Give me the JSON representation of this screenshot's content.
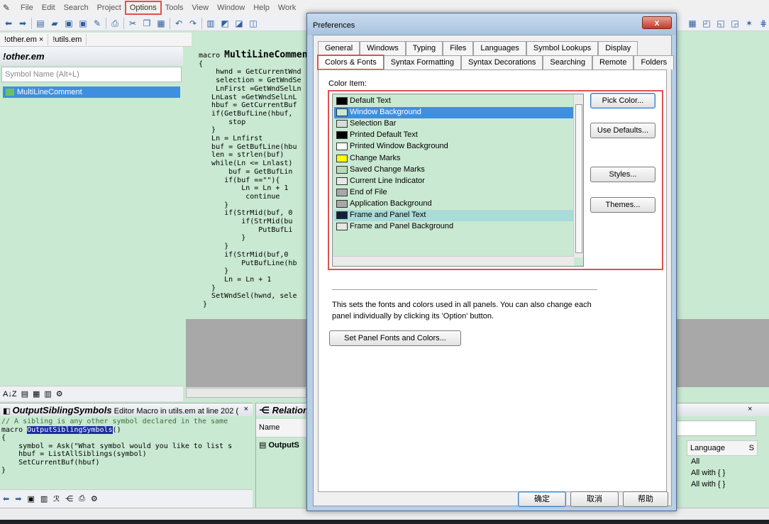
{
  "menubar": {
    "items": [
      "File",
      "Edit",
      "Search",
      "Project",
      "Options",
      "Tools",
      "View",
      "Window",
      "Help",
      "Work"
    ]
  },
  "file_tabs": [
    "!other.em",
    "!utils.em"
  ],
  "symbol_panel": {
    "title": "!other.em",
    "search_placeholder": "Symbol Name (Alt+L)",
    "item": "MultiLineComment"
  },
  "editor": {
    "lines": [
      [
        "macro ",
        "MultiLineCommen"
      ],
      [
        "{",
        ""
      ],
      [
        "    hwnd = GetCurrentWnd",
        ""
      ],
      [
        "    selection = GetWndSe",
        ""
      ],
      [
        "    LnFirst =GetWndSelLn",
        ""
      ],
      [
        "   LnLast =GetWndSelLnL",
        ""
      ],
      [
        "   hbuf = GetCurrentBuf",
        ""
      ],
      [
        "   if(GetBufLine(hbuf,",
        ""
      ],
      [
        "       stop",
        ""
      ],
      [
        "   }",
        ""
      ],
      [
        "   Ln = Lnfirst",
        ""
      ],
      [
        "   buf = GetBufLine(hbu",
        ""
      ],
      [
        "   len = strlen(buf)",
        ""
      ],
      [
        "   while(Ln <= Lnlast)",
        ""
      ],
      [
        "       buf = GetBufLin",
        ""
      ],
      [
        "      if(buf ==\"\"){",
        ""
      ],
      [
        "          Ln = Ln + 1",
        ""
      ],
      [
        "           continue",
        ""
      ],
      [
        "      }",
        ""
      ],
      [
        "      if(StrMid(buf, 0",
        ""
      ],
      [
        "          if(StrMid(bu",
        ""
      ],
      [
        "              PutBufLi",
        ""
      ],
      [
        "          }",
        ""
      ],
      [
        "      }",
        ""
      ],
      [
        "      if(StrMid(buf,0",
        ""
      ],
      [
        "          PutBufLine(hb",
        ""
      ],
      [
        "      }",
        ""
      ],
      [
        "      Ln = Ln + 1",
        ""
      ],
      [
        "   }",
        ""
      ],
      [
        "   SetWndSel(hwnd, sele",
        ""
      ],
      [
        " }",
        ""
      ]
    ]
  },
  "context_panel": {
    "symbol": "OutputSiblingSymbols",
    "info": "Editor Macro in utils.em at line 202 (",
    "code": [
      "// A sibling is any other symbol declared in the same ",
      "macro ",
      "{",
      "    symbol = Ask(\"What symbol would you like to list s",
      "    hbuf = ListAllSiblings(symbol)",
      "    SetCurrentBuf(hbuf)",
      "}"
    ],
    "macro_name": "OutputSiblingSymbols",
    "macro_paren": "()"
  },
  "relation_panel": {
    "title": "Relation",
    "column": "Name",
    "row": "OutputS"
  },
  "project_panel": {
    "column_language": "Language",
    "column_s": "S",
    "rows": [
      "All",
      "All with { }",
      "All with { }"
    ]
  },
  "dialog": {
    "title": "Preferences",
    "close": "x",
    "tabs_row1": [
      "General",
      "Windows",
      "Typing",
      "Files",
      "Languages",
      "Symbol Lookups",
      "Display"
    ],
    "tabs_row2": [
      "Colors & Fonts",
      "Syntax Formatting",
      "Syntax Decorations",
      "Searching",
      "Remote",
      "Folders"
    ],
    "color_item_label": "Color Item:",
    "color_items": [
      {
        "label": "Default Text",
        "color": "#000000"
      },
      {
        "label": "Window Background",
        "color": "#c9e9d2"
      },
      {
        "label": "Selection Bar",
        "color": "#d6ded6"
      },
      {
        "label": "Printed Default Text",
        "color": "#000000"
      },
      {
        "label": "Printed Window Background",
        "color": "#ffffff"
      },
      {
        "label": "Change Marks",
        "color": "#ffff00"
      },
      {
        "label": "Saved Change Marks",
        "color": "#b8d8b8"
      },
      {
        "label": "Current Line Indicator",
        "color": "#e8e8e8"
      },
      {
        "label": "End of File",
        "color": "#a8a8a8"
      },
      {
        "label": "Application Background",
        "color": "#a8a8a8"
      },
      {
        "label": "Frame and Panel Text",
        "color": "#10203a"
      },
      {
        "label": "Frame and Panel Background",
        "color": "#e6e6e6"
      }
    ],
    "selected_index": 1,
    "hover_index": 10,
    "buttons": {
      "pick_color": "Pick Color...",
      "use_defaults": "Use Defaults...",
      "styles": "Styles...",
      "themes": "Themes..."
    },
    "description": "This sets the fonts and colors used in all panels. You can also change each panel individually by clicking its 'Option' button.",
    "set_panel_button": "Set Panel Fonts and Colors...",
    "ok": "确定",
    "cancel": "取消",
    "help": "帮助"
  }
}
